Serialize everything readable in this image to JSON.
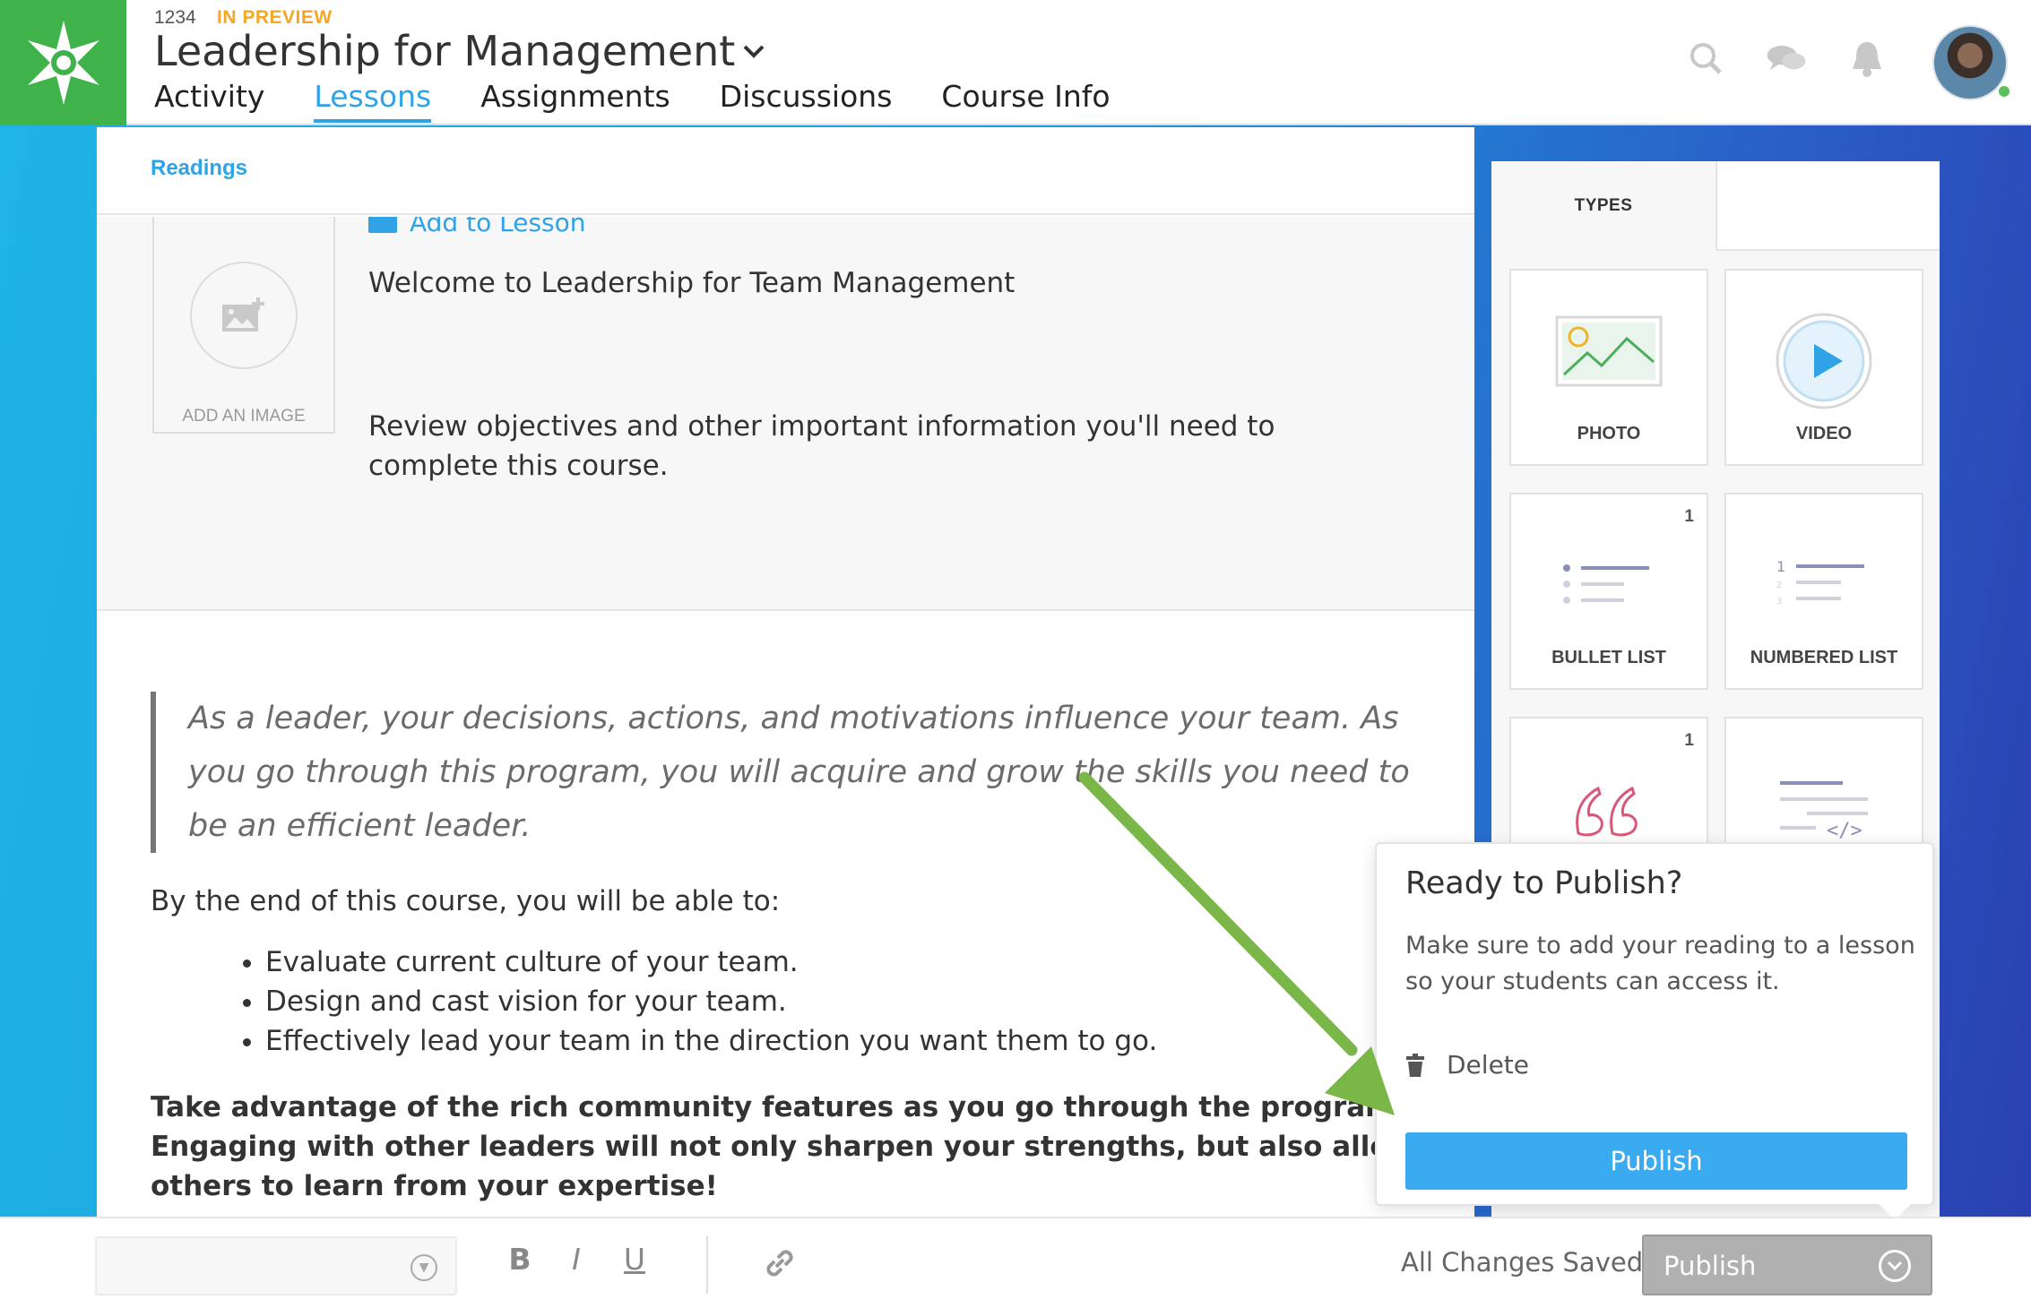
{
  "header": {
    "course_id": "1234",
    "status": "IN PREVIEW",
    "course_title": "Leadership for Management",
    "nav": [
      {
        "label": "Activity",
        "active": false
      },
      {
        "label": "Lessons",
        "active": true
      },
      {
        "label": "Assignments",
        "active": false
      },
      {
        "label": "Discussions",
        "active": false
      },
      {
        "label": "Course Info",
        "active": false
      }
    ],
    "icons": [
      "search-icon",
      "chat-icon",
      "bell-icon"
    ]
  },
  "content": {
    "breadcrumb": "Readings",
    "add_to_lesson": "Add to Lesson",
    "image_placeholder": "ADD AN IMAGE",
    "intro_title": "Welcome to Leadership for Team Management",
    "intro_description": "Review objectives and other important information you'll need to complete this course.",
    "quote": "As a leader, your decisions, actions, and motivations influence your team. As you go through this program, you will acquire and grow the skills you need to be an efficient leader.",
    "lead": "By the end of this course, you will be able to:",
    "objectives": [
      "Evaluate current culture of your team.",
      "Design and cast vision for your team.",
      "Effectively lead your team in the direction you want them to go."
    ],
    "cta": "Take advantage of the rich community features as you go through the program. Engaging with other leaders will not only sharpen your strengths, but also allow others to learn from your expertise!"
  },
  "types_panel": {
    "tab_label": "TYPES",
    "tiles": [
      {
        "label": "PHOTO",
        "count": ""
      },
      {
        "label": "VIDEO",
        "count": ""
      },
      {
        "label": "BULLET LIST",
        "count": "1"
      },
      {
        "label": "NUMBERED LIST",
        "count": ""
      },
      {
        "label": "",
        "count": "1"
      },
      {
        "label": "",
        "count": ""
      }
    ]
  },
  "popover": {
    "title": "Ready to Publish?",
    "text": "Make sure to add your reading to a lesson so your students can access it.",
    "delete_label": "Delete",
    "publish_label": "Publish"
  },
  "toolbar": {
    "bold": "B",
    "italic": "I",
    "underline": "U",
    "saved_status": "All Changes Saved",
    "publish_label": "Publish"
  },
  "colors": {
    "brand_green": "#3fb24a",
    "accent_blue": "#2fa3e6",
    "annotation_arrow": "#7ab648",
    "preview_orange": "#f5a623"
  }
}
